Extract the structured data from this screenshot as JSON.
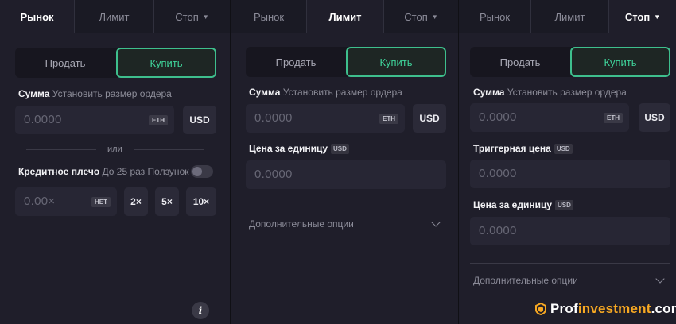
{
  "tabs": {
    "market": "Рынок",
    "limit": "Лимит",
    "stop": "Стоп"
  },
  "side": {
    "sell": "Продать",
    "buy": "Купить"
  },
  "amount": {
    "label": "Сумма",
    "hint": "Установить размер ордера",
    "placeholder": "0.0000",
    "unit": "ETH",
    "currency_button": "USD"
  },
  "or_label": "или",
  "leverage": {
    "label": "Кредитное плечо",
    "limit": "До 25 раз",
    "slider_label": "Ползунок",
    "placeholder": "0.00×",
    "none_tag": "НЕТ",
    "presets": [
      "2×",
      "5×",
      "10×"
    ]
  },
  "unit_price": {
    "label": "Цена за единицу",
    "tag": "USD",
    "placeholder": "0.0000"
  },
  "trigger_price": {
    "label": "Триггерная цена",
    "tag": "USD",
    "placeholder": "0.0000"
  },
  "advanced_options": "Дополнительные опции",
  "info_glyph": "i",
  "watermark": {
    "prefix": "Prof",
    "highlight": "investment",
    "suffix": ".com"
  },
  "colors": {
    "accent": "#3ebf8d",
    "panel": "#1f1e2a",
    "watermark_accent": "#f7a822"
  }
}
